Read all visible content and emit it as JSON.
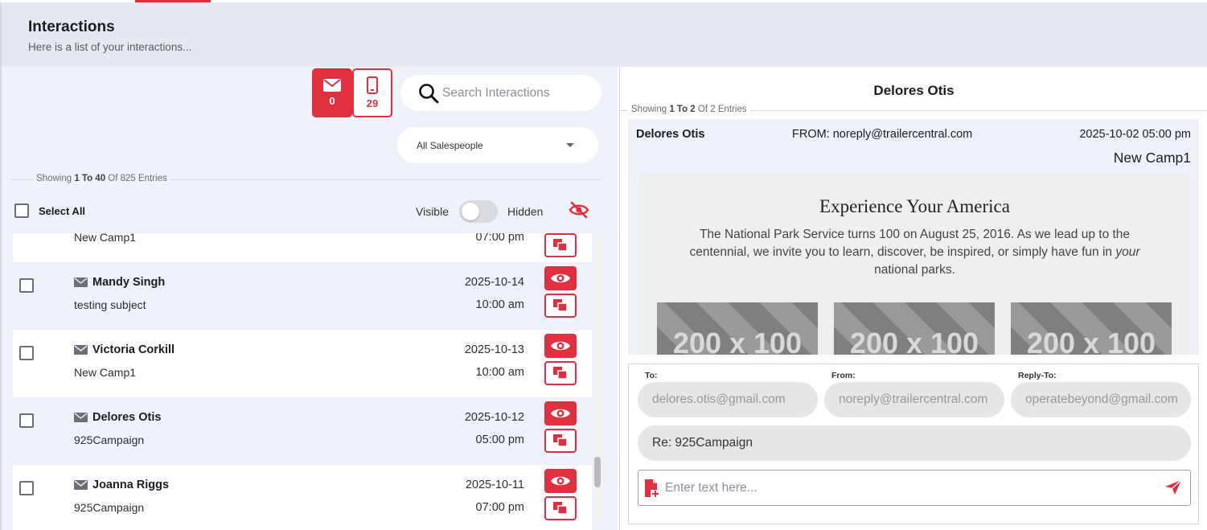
{
  "header": {
    "title": "Interactions",
    "subtitle": "Here is a list of your interactions..."
  },
  "channels": {
    "email_count": "0",
    "sms_count": "29"
  },
  "search": {
    "placeholder": "Search Interactions"
  },
  "salespeople": {
    "selected": "All Salespeople"
  },
  "list_info": {
    "prefix": "Showing ",
    "range": "1 To 40",
    "suffix": " Of 825 Entries"
  },
  "controls": {
    "select_all": "Select All",
    "visible": "Visible",
    "hidden": "Hidden"
  },
  "rows": [
    {
      "name": "",
      "subject": "New Camp1",
      "date": "",
      "time": "07:00 pm"
    },
    {
      "name": "Mandy Singh",
      "subject": "testing subject",
      "date": "2025-10-14",
      "time": "10:00 am"
    },
    {
      "name": "Victoria Corkill",
      "subject": "New Camp1",
      "date": "2025-10-13",
      "time": "10:00 am"
    },
    {
      "name": "Delores Otis",
      "subject": "925Campaign",
      "date": "2025-10-12",
      "time": "05:00 pm"
    },
    {
      "name": "Joanna Riggs",
      "subject": "925Campaign",
      "date": "2025-10-11",
      "time": "07:00 pm"
    }
  ],
  "detail": {
    "title": "Delores Otis",
    "info": {
      "prefix": "Showing ",
      "range": "1 To 2",
      "suffix": " Of 2 Entries"
    },
    "message": {
      "from_name": "Delores Otis",
      "from_address": "FROM: noreply@trailercentral.com",
      "timestamp": "2025-10-02 05:00 pm",
      "subject": "New Camp1",
      "body_heading": "Experience Your America",
      "body_text_1": "The National Park Service turns 100 on August 25, 2016. As we lead up to the centennial, we invite you to learn, discover, be inspired, or simply have fun in ",
      "body_text_em": "your",
      "body_text_2": " national parks.",
      "placeholder_label": "200 x 100"
    },
    "composer": {
      "to_label": "To:",
      "from_label": "From:",
      "reply_label": "Reply-To:",
      "to_value": "delores.otis@gmail.com",
      "from_value": "noreply@trailercentral.com",
      "reply_value": "operatebeyond@gmail.com",
      "subject_value": "Re: 925Campaign",
      "message_placeholder": "Enter text here..."
    }
  },
  "colors": {
    "accent": "#e0303f",
    "panel_bg": "#eff2f8",
    "header_bg": "#e6e9f0"
  }
}
